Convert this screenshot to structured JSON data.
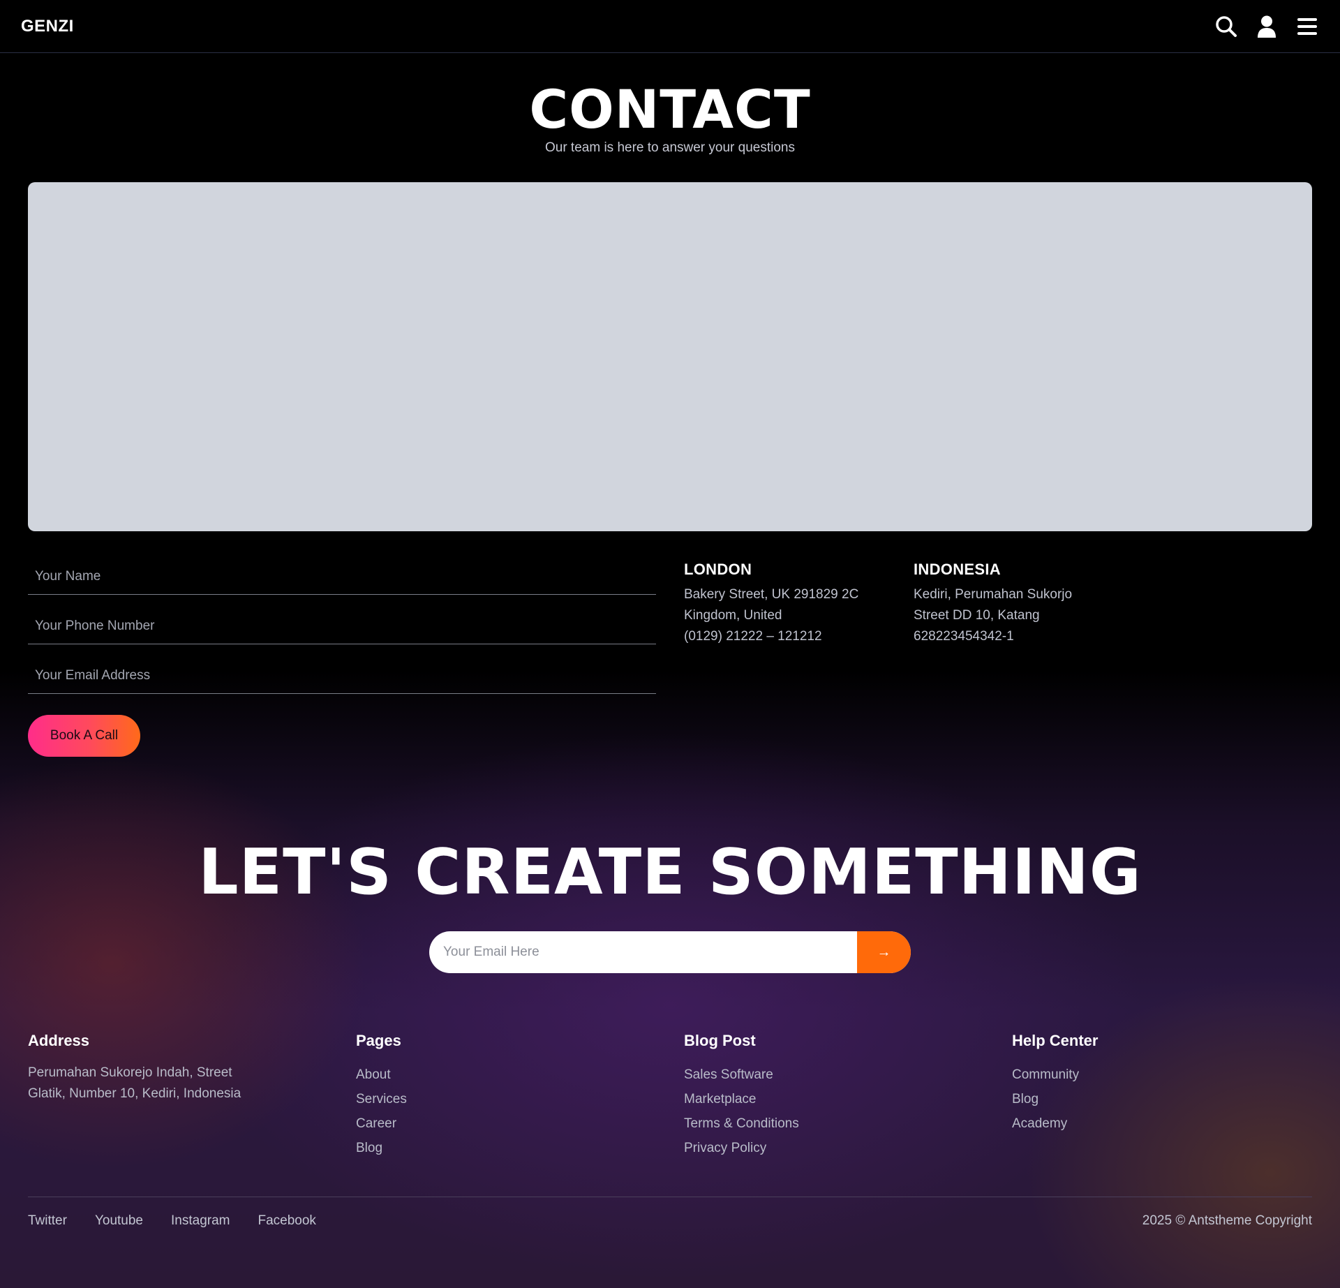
{
  "header": {
    "logo": "GENZI",
    "icons": [
      "search-icon",
      "user-icon",
      "menu-icon"
    ]
  },
  "hero": {
    "title": "CONTACT",
    "subtitle": "Our team is here to answer your questions"
  },
  "form": {
    "name_placeholder": "Your Name",
    "phone_placeholder": "Your Phone Number",
    "email_placeholder": "Your Email Address",
    "submit_label": "Book A Call"
  },
  "offices": [
    {
      "title": "LONDON",
      "line1": "Bakery Street, UK 291829 2C",
      "line2": "Kingdom, United",
      "line3": "(0129) 21222 – 121212"
    },
    {
      "title": "INDONESIA",
      "line1": "Kediri, Perumahan Sukorjo",
      "line2": "Street DD 10, Katang",
      "line3": "628223454342-1"
    }
  ],
  "cta": {
    "title": "LET'S CREATE SOMETHING",
    "email_placeholder": "Your Email Here",
    "submit_symbol": "→"
  },
  "footer": {
    "address": {
      "title": "Address",
      "line1": "Perumahan Sukorejo Indah, Street",
      "line2": "Glatik, Number 10, Kediri, Indonesia"
    },
    "pages": {
      "title": "Pages",
      "items": [
        "About",
        "Services",
        "Career",
        "Blog"
      ]
    },
    "blog": {
      "title": "Blog Post",
      "items": [
        "Sales Software",
        "Marketplace",
        "Terms & Conditions",
        "Privacy Policy"
      ]
    },
    "help": {
      "title": "Help Center",
      "items": [
        "Community",
        "Blog",
        "Academy"
      ]
    },
    "social": [
      "Twitter",
      "Youtube",
      "Instagram",
      "Facebook"
    ],
    "copyright": "2025 © Antstheme Copyright"
  },
  "colors": {
    "accent_orange": "#ff6a0a",
    "accent_pink": "#ff2d8a",
    "map_placeholder": "#d1d5dd"
  }
}
